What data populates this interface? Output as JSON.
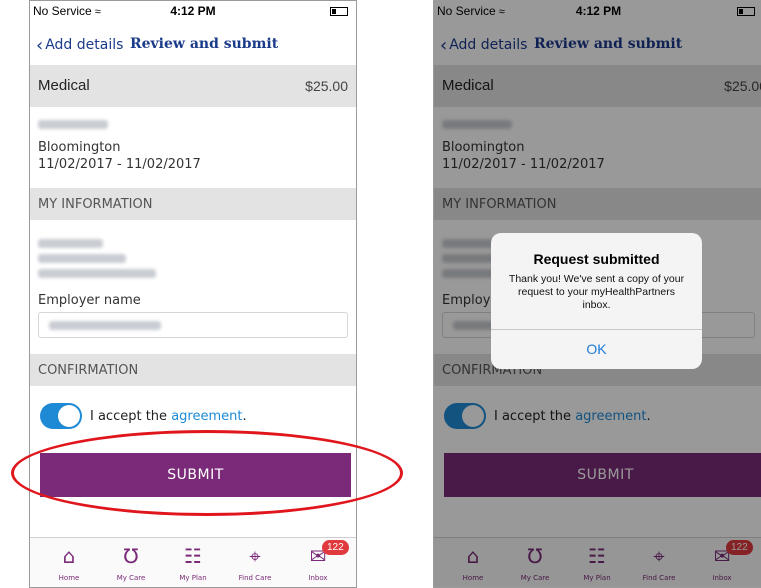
{
  "status": {
    "carrier": "No Service",
    "time": "4:12 PM"
  },
  "nav": {
    "back_label": "Add details",
    "title": "Review and submit"
  },
  "claim": {
    "type": "Medical",
    "amount": "$25.00",
    "location": "Bloomington",
    "dates": "11/02/2017 - 11/02/2017"
  },
  "sections": {
    "my_information": "MY INFORMATION",
    "confirmation": "CONFIRMATION"
  },
  "employer": {
    "label": "Employer name"
  },
  "agreement": {
    "prefix": "I accept the",
    "link": "agreement",
    "suffix": ".",
    "accepted": true
  },
  "submit_label": "SUBMIT",
  "tabs": [
    {
      "label": "Home",
      "icon": "home-icon"
    },
    {
      "label": "My Care",
      "icon": "stethoscope-icon"
    },
    {
      "label": "My Plan",
      "icon": "document-icon"
    },
    {
      "label": "Find Care",
      "icon": "location-pin-icon"
    },
    {
      "label": "Inbox",
      "icon": "mail-icon",
      "badge": "122"
    }
  ],
  "dialog": {
    "title": "Request submitted",
    "message": "Thank you! We've sent a copy of your request to your myHealthPartners inbox.",
    "ok_label": "OK"
  },
  "colors": {
    "brand_purple": "#7a2a78",
    "nav_blue": "#1a3a8a",
    "toggle_blue": "#1e8ad6",
    "highlight_red": "#e0161c",
    "badge_red": "#e0393e"
  }
}
